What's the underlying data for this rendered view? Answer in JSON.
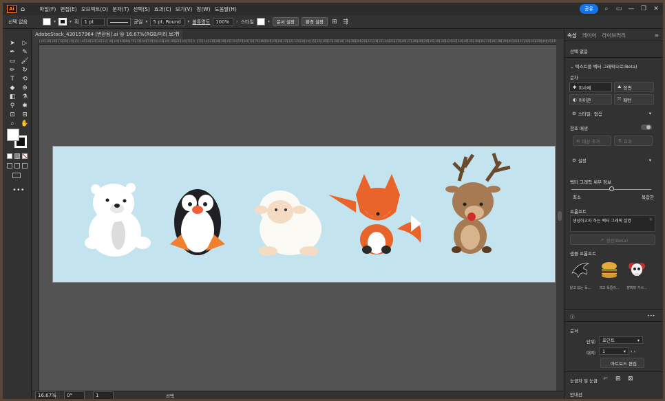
{
  "menubar": {
    "logo": "Ai",
    "items": [
      "파일(F)",
      "편집(E)",
      "오브젝트(O)",
      "문자(T)",
      "선택(S)",
      "효과(C)",
      "보기(V)",
      "창(W)",
      "도움말(H)"
    ],
    "share_label": "공유"
  },
  "controlbar": {
    "selection_label": "선택 없음",
    "stroke_label": "획",
    "stroke_weight": "1 pt",
    "profile_label": "균일",
    "brush": "5 pt. Round",
    "opacity_label": "불투명도",
    "opacity": "100%",
    "style_label": "스타일",
    "doc_setup": "문서 설정",
    "preferences": "환경 설정"
  },
  "document": {
    "tab_title": "AdobeStock_430157964 [변환됨].ai @ 16.67%(RGB/미리 보기)",
    "ruler_ticks": [
      "1944",
      "1872",
      "1800",
      "1728",
      "1656",
      "1584",
      "1512",
      "1440",
      "1368",
      "1296",
      "1224",
      "1152",
      "1080",
      "1008",
      "936",
      "864",
      "792",
      "720",
      "648",
      "576",
      "504",
      "432",
      "360",
      "288",
      "216",
      "144",
      "72",
      "0",
      "72",
      "144",
      "216",
      "288",
      "360",
      "432",
      "504",
      "576",
      "648",
      "720",
      "792",
      "864",
      "936",
      "1008",
      "1080",
      "1152",
      "1224",
      "1296",
      "1368",
      "1440",
      "1512",
      "1584",
      "1656",
      "1728",
      "1800",
      "1872",
      "1944",
      "2016",
      "2088",
      "2160",
      "2232",
      "2304",
      "2376",
      "2448",
      "2520",
      "2592",
      "2664",
      "2736",
      "2808",
      "2880",
      "2952",
      "3024",
      "3096",
      "3168",
      "3240",
      "3312",
      "3384",
      "3456",
      "3528",
      "3600",
      "3672",
      "3744",
      "3816",
      "3888",
      "3960",
      "4032",
      "4104",
      "4176",
      "4248",
      "4320",
      "4392",
      "4464",
      "4536",
      "4608"
    ]
  },
  "statusbar": {
    "zoom": "16.67%",
    "rotation": "0°",
    "artboard_num": "1",
    "tool": "선택"
  },
  "panel": {
    "tabs": [
      "속성",
      "레이어",
      "라이브러리"
    ],
    "no_selection": "선택 없음",
    "vectorize_header": "텍스트를 벡터 그래픽으로(Beta)",
    "subject_label": "문자",
    "subject_options": [
      "피사체",
      "장면",
      "아이콘",
      "패턴"
    ],
    "style_label": "스타일:",
    "style_value": "없음",
    "reference_label": "참조 매생",
    "ref_btn1": "대상 추가",
    "ref_btn2": "효과",
    "settings_label": "설정",
    "detail_label": "벡터 그래픽 세부 정보",
    "detail_min": "최소",
    "detail_max": "복잡한",
    "prompt_label": "프롬프트",
    "prompt_placeholder": "생성하고자 하는 벡터 그래픽 설명",
    "generate_label": "생성(Beta)",
    "samples_label": "샘플 프롬프트",
    "samples": [
      "날고 있는 독...",
      "크고 육즙이...",
      "장미와 가시..."
    ],
    "doc_section": "문서",
    "units_label": "단위:",
    "units_value": "포인트",
    "artboard_label": "대지:",
    "artboard_value": "1",
    "edit_artboards": "아트보드 편집",
    "rulers_grids": "눈금자 및 눈금",
    "guides": "안내선"
  }
}
